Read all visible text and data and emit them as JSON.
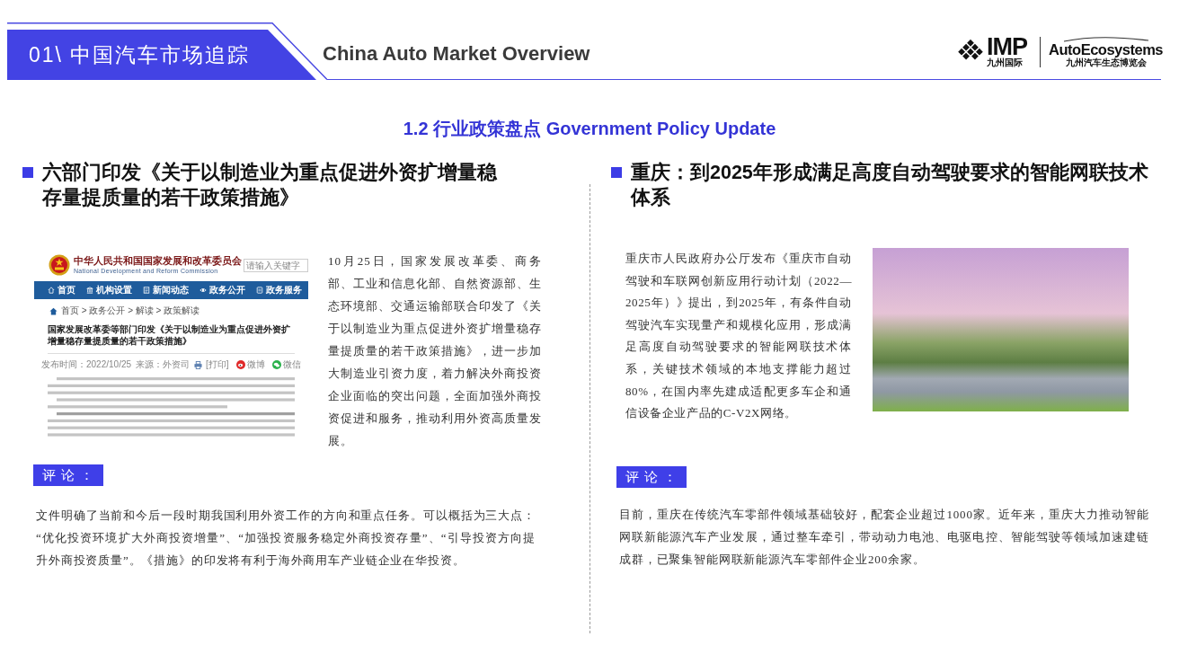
{
  "header": {
    "chapter": "01\\ 中国汽车市场追踪",
    "subtitle": "China Auto Market Overview",
    "logos": [
      {
        "kind": "imp",
        "wordmark": "IMP",
        "caption": "九州国际"
      },
      {
        "kind": "autoeco",
        "wordmark": "AutoEcosystems",
        "caption": "九州汽车生态博览会"
      }
    ]
  },
  "section_title": "1.2 行业政策盘点 Government Policy Update",
  "panels": [
    {
      "kind": "screenshot",
      "heading": "六部门印发《关于以制造业为重点促进外资扩增量稳存量提质量的若干政策措施》",
      "screenshot": {
        "site_name": "中华人民共和国国家发展和改革委员会",
        "site_name_en": "National Development and Reform Commission",
        "search": {
          "placeholder": "请输入关键字"
        },
        "nav": [
          "首页",
          "机构设置",
          "新闻动态",
          "政务公开",
          "政务服务"
        ],
        "breadcrumb": "首页 > 政务公开 > 解读 > 政策解读",
        "title": "国家发展改革委等部门印发《关于以制造业为重点促进外资扩增量稳存量提质量的若干政策措施》",
        "published": "发布时间：2022/10/25",
        "source": "来源：外资司",
        "print": "[打印]",
        "share": [
          {
            "kind": "weibo",
            "label": "微博"
          },
          {
            "kind": "wechat",
            "label": "微信"
          }
        ]
      },
      "body": "10月25日，国家发展改革委、商务部、工业和信息化部、自然资源部、生态环境部、交通运输部联合印发了《关于以制造业为重点促进外资扩增量稳存量提质量的若干政策措施》，进一步加大制造业引资力度，着力解决外商投资企业面临的突出问题，全面加强外商投资促进和服务，推动利用外资高质量发展。",
      "comment_label": "评 论 ：",
      "comment": "文件明确了当前和今后一段时期我国利用外资工作的方向和重点任务。可以概括为三大点：“优化投资环境扩大外商投资增量”、“加强投资服务稳定外商投资存量”、“引导投资方向提升外商投资质量”。《措施》的印发将有利于海外商用车产业链企业在华投资。"
    },
    {
      "kind": "photo",
      "heading": "重庆：到2025年形成满足高度自动驾驶要求的智能网联技术体系",
      "body": "重庆市人民政府办公厅发布《重庆市自动驾驶和车联网创新应用行动计划（2022—2025年）》提出，到2025年，有条件自动驾驶汽车实现量产和规模化应用，形成满足高度自动驾驶要求的智能网联技术体系，关键技术领域的本地支撑能力超过80%，在国内率先建成适配更多车企和通信设备企业产品的C-V2X网络。",
      "comment_label": "评 论 ：",
      "comment": "目前，重庆在传统汽车零部件领域基础较好，配套企业超过1000家。近年来，重庆大力推动智能网联新能源汽车产业发展，通过整车牵引，带动动力电池、电驱电控、智能驾驶等领域加速建链成群，已聚集智能网联新能源汽车零部件企业200余家。"
    }
  ]
}
